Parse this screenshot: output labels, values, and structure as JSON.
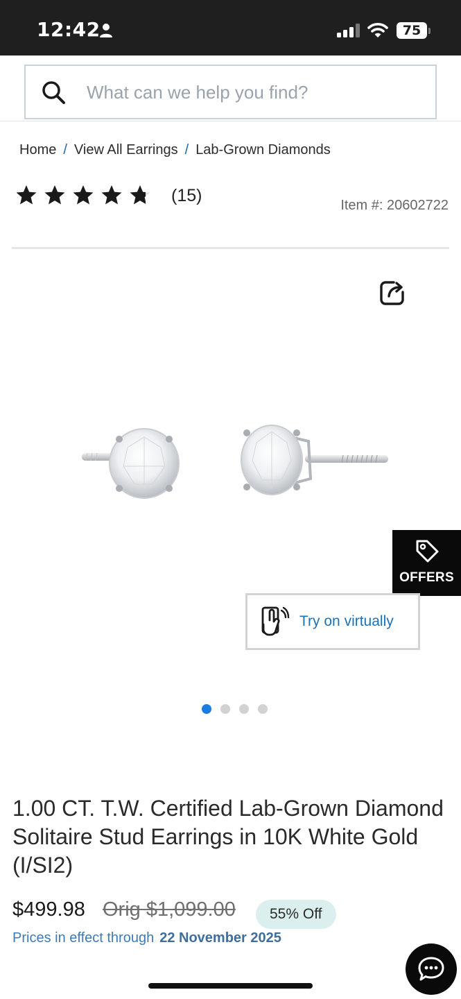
{
  "status_bar": {
    "time": "12:42",
    "battery": "75",
    "icons": [
      "person-icon",
      "cellular-signal-icon",
      "wifi-icon",
      "battery-icon"
    ]
  },
  "search": {
    "placeholder": "What can we help you find?",
    "value": "",
    "icon": "search-icon"
  },
  "breadcrumb": {
    "items": [
      "Home",
      "View All Earrings",
      "Lab-Grown Diamonds"
    ],
    "separator": "/"
  },
  "rating": {
    "stars": 4.7,
    "max_stars": 5,
    "review_count": "(15)"
  },
  "item_number": "Item #: 20602722",
  "gallery": {
    "share_icon": "share-icon",
    "image_subject": "diamond-stud-earrings",
    "total_slides": 4,
    "active_slide": 1
  },
  "offers": {
    "label": "OFFERS",
    "icon": "tag-icon"
  },
  "try_on": {
    "label": "Try on virtually",
    "icon": "hand-phone-icon"
  },
  "product": {
    "title": "1.00 CT. T.W. Certified Lab-Grown Diamond Solitaire Stud Earrings in 10K White Gold (I/SI2)",
    "price": "$499.98",
    "original_price": "Orig $1,099.00",
    "discount": "55% Off",
    "price_note": "Prices in effect through",
    "price_note_date": "22 November 2025"
  },
  "chat": {
    "icon": "chat-icon"
  },
  "colors": {
    "accent_blue": "#1a72b9",
    "active_dot": "#1a7ce0",
    "discount_badge_bg": "#dcefef",
    "status_bar_bg": "#1f1f1f",
    "offers_bg": "#0a0a0a"
  }
}
